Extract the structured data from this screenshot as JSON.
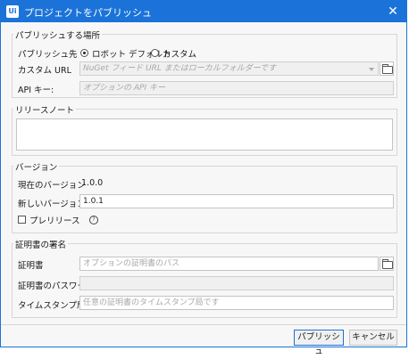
{
  "window": {
    "app_icon": "Ui",
    "title": "プロジェクトをパブリッシュ",
    "close_glyph": "✕"
  },
  "publish_location": {
    "legend": "パブリッシュする場所",
    "publish_to_label": "パブリッシュ先",
    "options": [
      {
        "label": "ロボット デフォルト",
        "selected": true
      },
      {
        "label": "カスタム",
        "selected": false
      }
    ],
    "custom_url_label": "カスタム URL",
    "custom_url_placeholder": "NuGet フィード URL またはローカルフォルダーです",
    "api_key_label": "API キー:",
    "api_key_placeholder": "オプションの API キー"
  },
  "release_notes": {
    "legend": "リリースノート",
    "value": ""
  },
  "version": {
    "legend": "バージョン",
    "current_label": "現在のバージョン",
    "current_value": "1.0.0",
    "new_label": "新しいバージョン",
    "new_value": "1.0.1",
    "prerelease_label": "プレリリース",
    "prerelease_checked": false,
    "help_glyph": "?"
  },
  "signing": {
    "legend": "証明書の署名",
    "certificate_label": "証明書",
    "certificate_placeholder": "オプションの証明書のパス",
    "password_label": "証明書のパスワード",
    "timestamp_label": "タイムスタンプ局",
    "timestamp_placeholder": "任意の証明書のタイムスタンプ局です"
  },
  "footer": {
    "publish_label": "パブリッシュ",
    "cancel_label": "キャンセル"
  },
  "colors": {
    "accent": "#1b73d9",
    "background": "#f7f7f7"
  }
}
